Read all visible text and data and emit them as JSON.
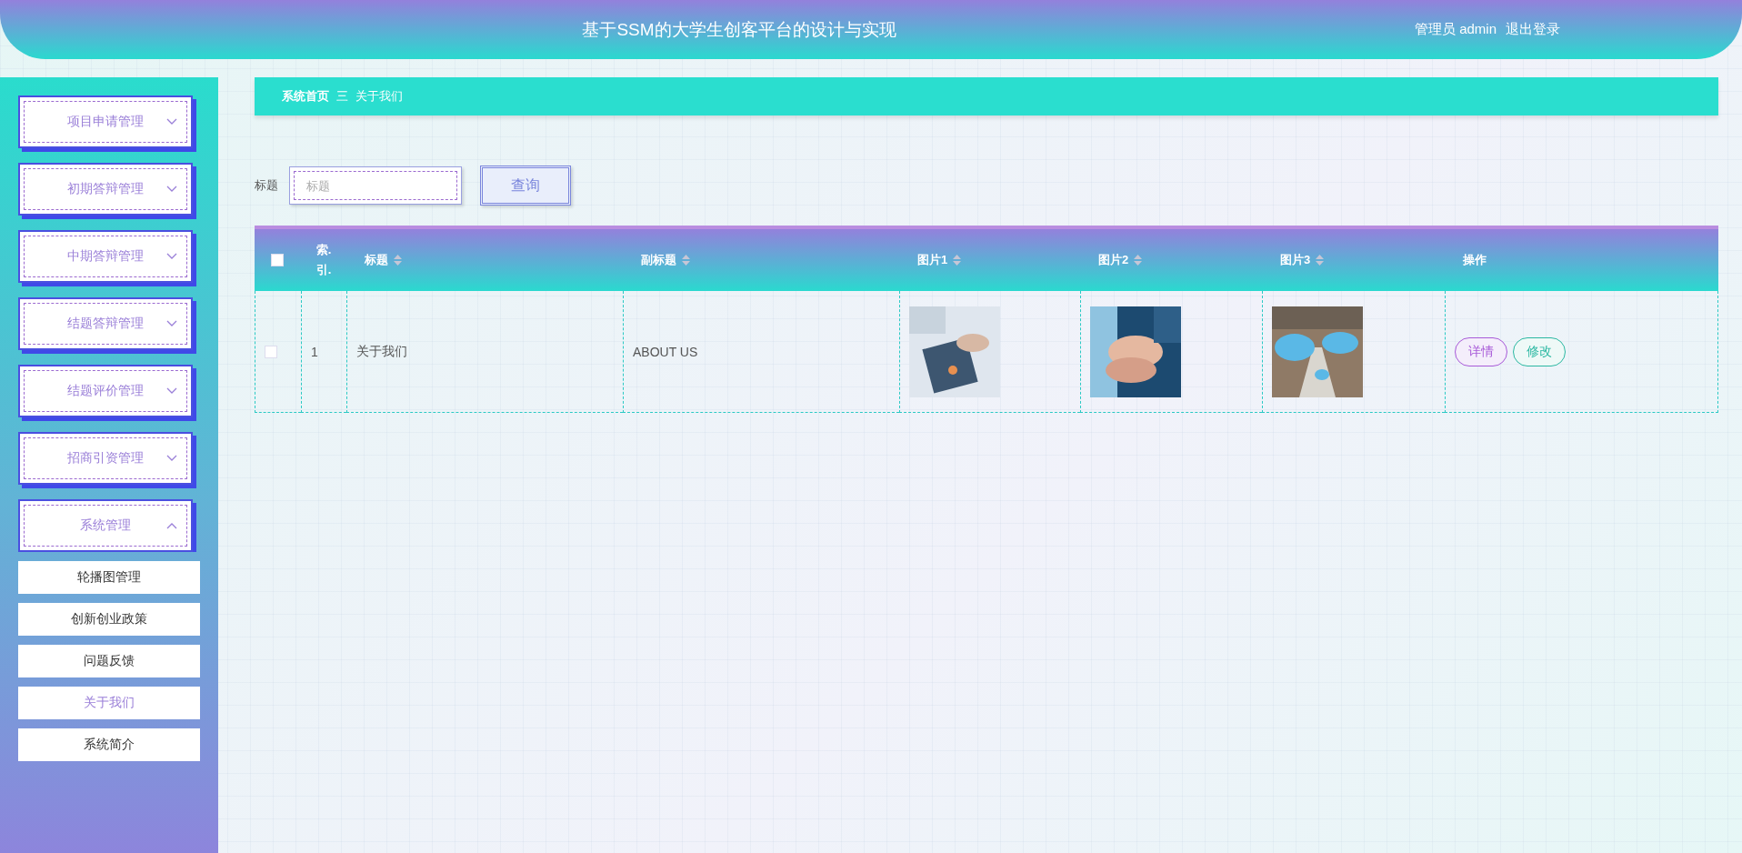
{
  "header": {
    "title": "基于SSM的大学生创客平台的设计与实现",
    "user": "管理员 admin",
    "logout": "退出登录"
  },
  "sidebar": {
    "items": [
      {
        "label": "项目申请管理",
        "expanded": false
      },
      {
        "label": "初期答辩管理",
        "expanded": false
      },
      {
        "label": "中期答辩管理",
        "expanded": false
      },
      {
        "label": "结题答辩管理",
        "expanded": false
      },
      {
        "label": "结题评价管理",
        "expanded": false
      },
      {
        "label": "招商引资管理",
        "expanded": false
      },
      {
        "label": "系统管理",
        "expanded": true,
        "children": [
          {
            "label": "轮播图管理",
            "selected": false
          },
          {
            "label": "创新创业政策",
            "selected": false
          },
          {
            "label": "问题反馈",
            "selected": false
          },
          {
            "label": "关于我们",
            "selected": true
          },
          {
            "label": "系统简介",
            "selected": false
          }
        ]
      }
    ]
  },
  "breadcrumb": {
    "home": "系统首页",
    "separator": "三",
    "current": "关于我们"
  },
  "search": {
    "label": "标题",
    "placeholder": "标题",
    "button": "查询"
  },
  "table": {
    "select_all": {
      "checked": false
    },
    "columns": [
      {
        "label": "索.引.",
        "sortable": false
      },
      {
        "label": "标题",
        "sortable": true
      },
      {
        "label": "副标题",
        "sortable": true
      },
      {
        "label": "图片1",
        "sortable": true
      },
      {
        "label": "图片2",
        "sortable": true
      },
      {
        "label": "图片3",
        "sortable": true
      },
      {
        "label": "操作",
        "sortable": false
      }
    ],
    "rows": [
      {
        "checked": false,
        "index": "1",
        "title": "关于我们",
        "subtitle": "ABOUT US",
        "images": [
          {
            "kind": "picture"
          },
          {
            "kind": "picture"
          },
          {
            "kind": "picture"
          }
        ],
        "actions": [
          {
            "label": "详情",
            "kind": "detail"
          },
          {
            "label": "修改",
            "kind": "edit"
          }
        ]
      }
    ]
  }
}
